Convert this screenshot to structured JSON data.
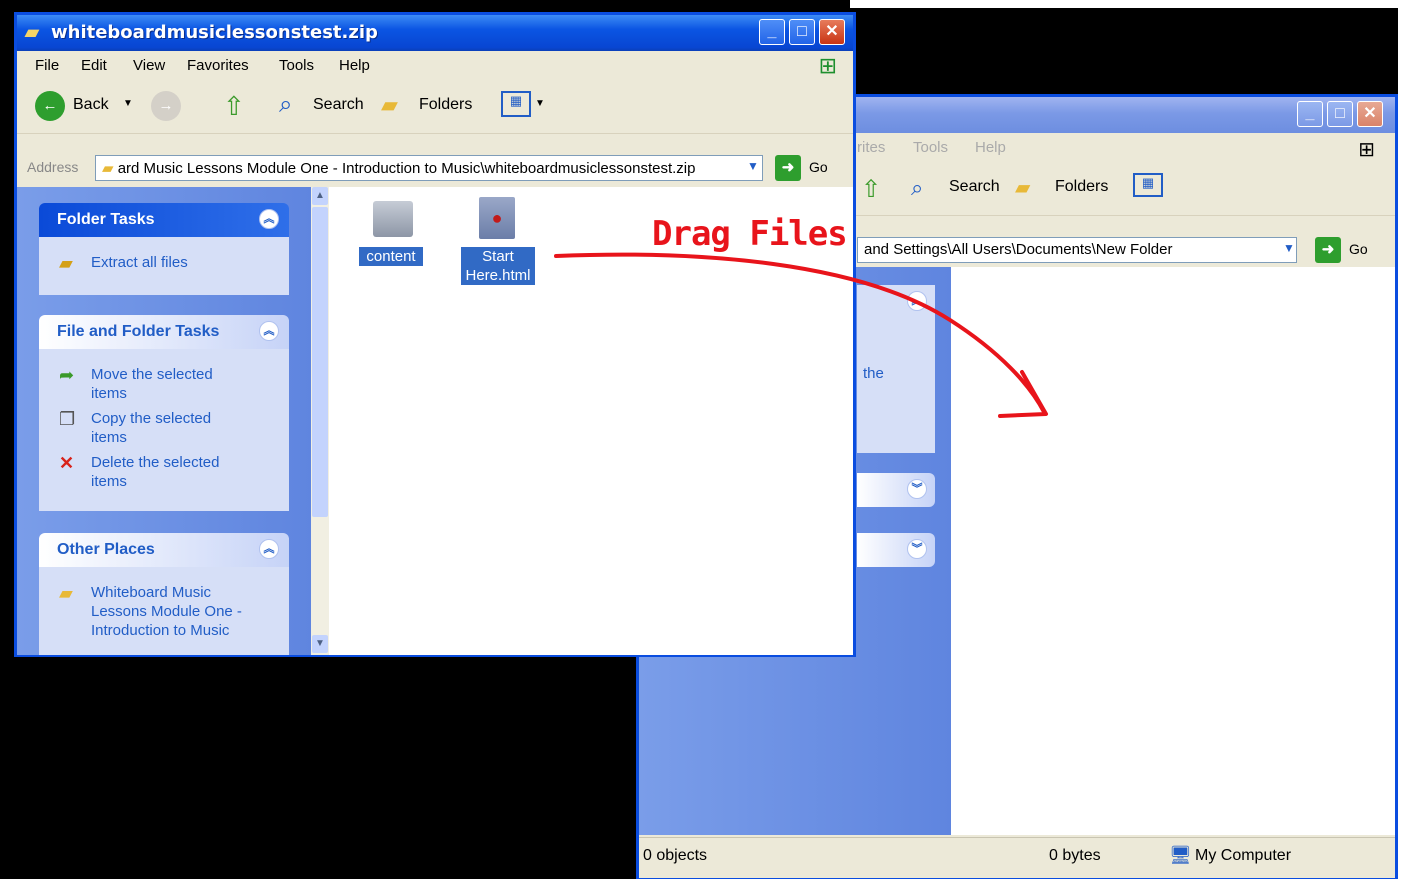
{
  "annotation": {
    "text": "Drag Files"
  },
  "front_window": {
    "title": "whiteboardmusiclessonstest.zip",
    "menu": [
      "File",
      "Edit",
      "View",
      "Favorites",
      "Tools",
      "Help"
    ],
    "toolbar": {
      "back": "Back",
      "search": "Search",
      "folders": "Folders"
    },
    "address": {
      "label": "Address",
      "value": "ard Music Lessons Module One - Introduction to Music\\whiteboardmusiclessonstest.zip",
      "go": "Go"
    },
    "folder_tasks": {
      "title": "Folder Tasks",
      "items": [
        "Extract all files"
      ]
    },
    "file_tasks": {
      "title": "File and Folder Tasks",
      "items": [
        "Move the selected items",
        "Copy the selected items",
        "Delete the selected items"
      ]
    },
    "other_places": {
      "title": "Other Places",
      "items": [
        "Whiteboard Music Lessons Module One - Introduction to Music"
      ]
    },
    "files": [
      {
        "name": "content",
        "icon": "folder-icon"
      },
      {
        "name": "Start Here.html",
        "icon": "html-file-icon"
      }
    ]
  },
  "back_window": {
    "menu": [
      "rites",
      "Tools",
      "Help"
    ],
    "toolbar": {
      "search": "Search",
      "folders": "Folders"
    },
    "address": {
      "value": "and Settings\\All Users\\Documents\\New Folder",
      "go": "Go"
    },
    "task_fragment": "the",
    "status": {
      "objects": "0 objects",
      "size": "0 bytes",
      "location": "My Computer"
    }
  },
  "colors": {
    "accent": "#0a4de0",
    "annotation": "#e8141b",
    "selection": "#316ac5"
  }
}
